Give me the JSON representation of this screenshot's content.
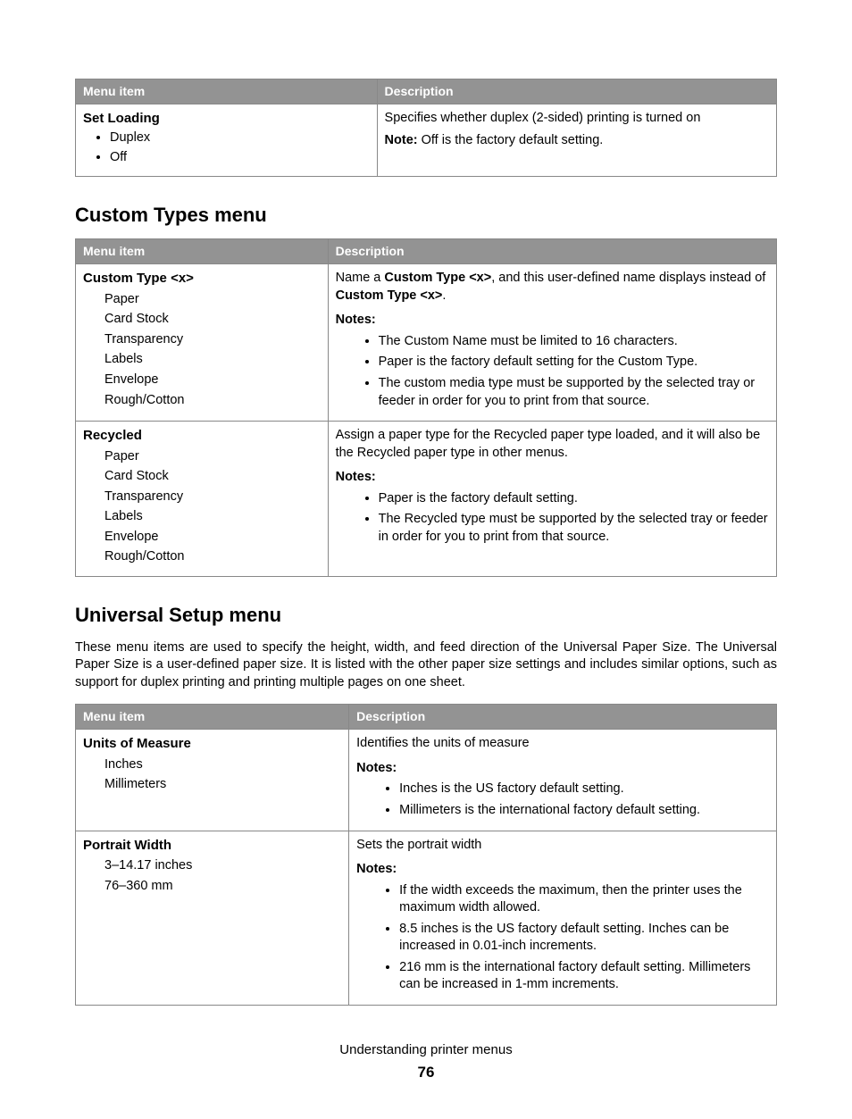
{
  "table1": {
    "headers": [
      "Menu item",
      "Description"
    ],
    "row": {
      "title": "Set Loading",
      "options": [
        "Duplex",
        "Off"
      ],
      "desc_line": "Specifies whether duplex (2-sided) printing is turned on",
      "note_label": "Note:",
      "note_text": " Off is the factory default setting."
    }
  },
  "heading_custom": "Custom Types menu",
  "table2": {
    "headers": [
      "Menu item",
      "Description"
    ],
    "row1": {
      "title": "Custom Type <x>",
      "options": [
        "Paper",
        "Card Stock",
        "Transparency",
        "Labels",
        "Envelope",
        "Rough/Cotton"
      ],
      "desc_pre": "Name a ",
      "desc_b1": "Custom Type <x>",
      "desc_mid": ", and this user-defined name displays instead of ",
      "desc_b2": "Custom Type <x>",
      "desc_post": ".",
      "notes_label": "Notes:",
      "notes": [
        "The Custom Name must be limited to 16 characters.",
        "Paper is the factory default setting for the Custom Type.",
        "The custom media type must be supported by the selected tray or feeder in order for you to print from that source."
      ]
    },
    "row2": {
      "title": "Recycled",
      "options": [
        "Paper",
        "Card Stock",
        "Transparency",
        "Labels",
        "Envelope",
        "Rough/Cotton"
      ],
      "desc": "Assign a paper type for the Recycled paper type loaded, and it will also be the Recycled paper type in other menus.",
      "notes_label": "Notes:",
      "notes": [
        "Paper is the factory default setting.",
        "The Recycled type must be supported by the selected tray or feeder in order for you to print from that source."
      ]
    }
  },
  "heading_universal": "Universal Setup menu",
  "universal_intro": "These menu items are used to specify the height, width, and feed direction of the Universal Paper Size. The Universal Paper Size is a user-defined paper size. It is listed with the other paper size settings and includes similar options, such as support for duplex printing and printing multiple pages on one sheet.",
  "table3": {
    "headers": [
      "Menu item",
      "Description"
    ],
    "row1": {
      "title": "Units of Measure",
      "options": [
        "Inches",
        "Millimeters"
      ],
      "desc": "Identifies the units of measure",
      "notes_label": "Notes:",
      "notes": [
        "Inches is the US factory default setting.",
        "Millimeters is the international factory default setting."
      ]
    },
    "row2": {
      "title": "Portrait Width",
      "options": [
        "3–14.17 inches",
        "76–360 mm"
      ],
      "desc": "Sets the portrait width",
      "notes_label": "Notes:",
      "notes": [
        "If the width exceeds the maximum, then the printer uses the maximum width allowed.",
        "8.5 inches is the US factory default setting. Inches can be increased in 0.01-inch increments.",
        "216 mm is the international factory default setting. Millimeters can be increased in 1-mm increments."
      ]
    }
  },
  "footer_text": "Understanding printer menus",
  "page_number": "76"
}
